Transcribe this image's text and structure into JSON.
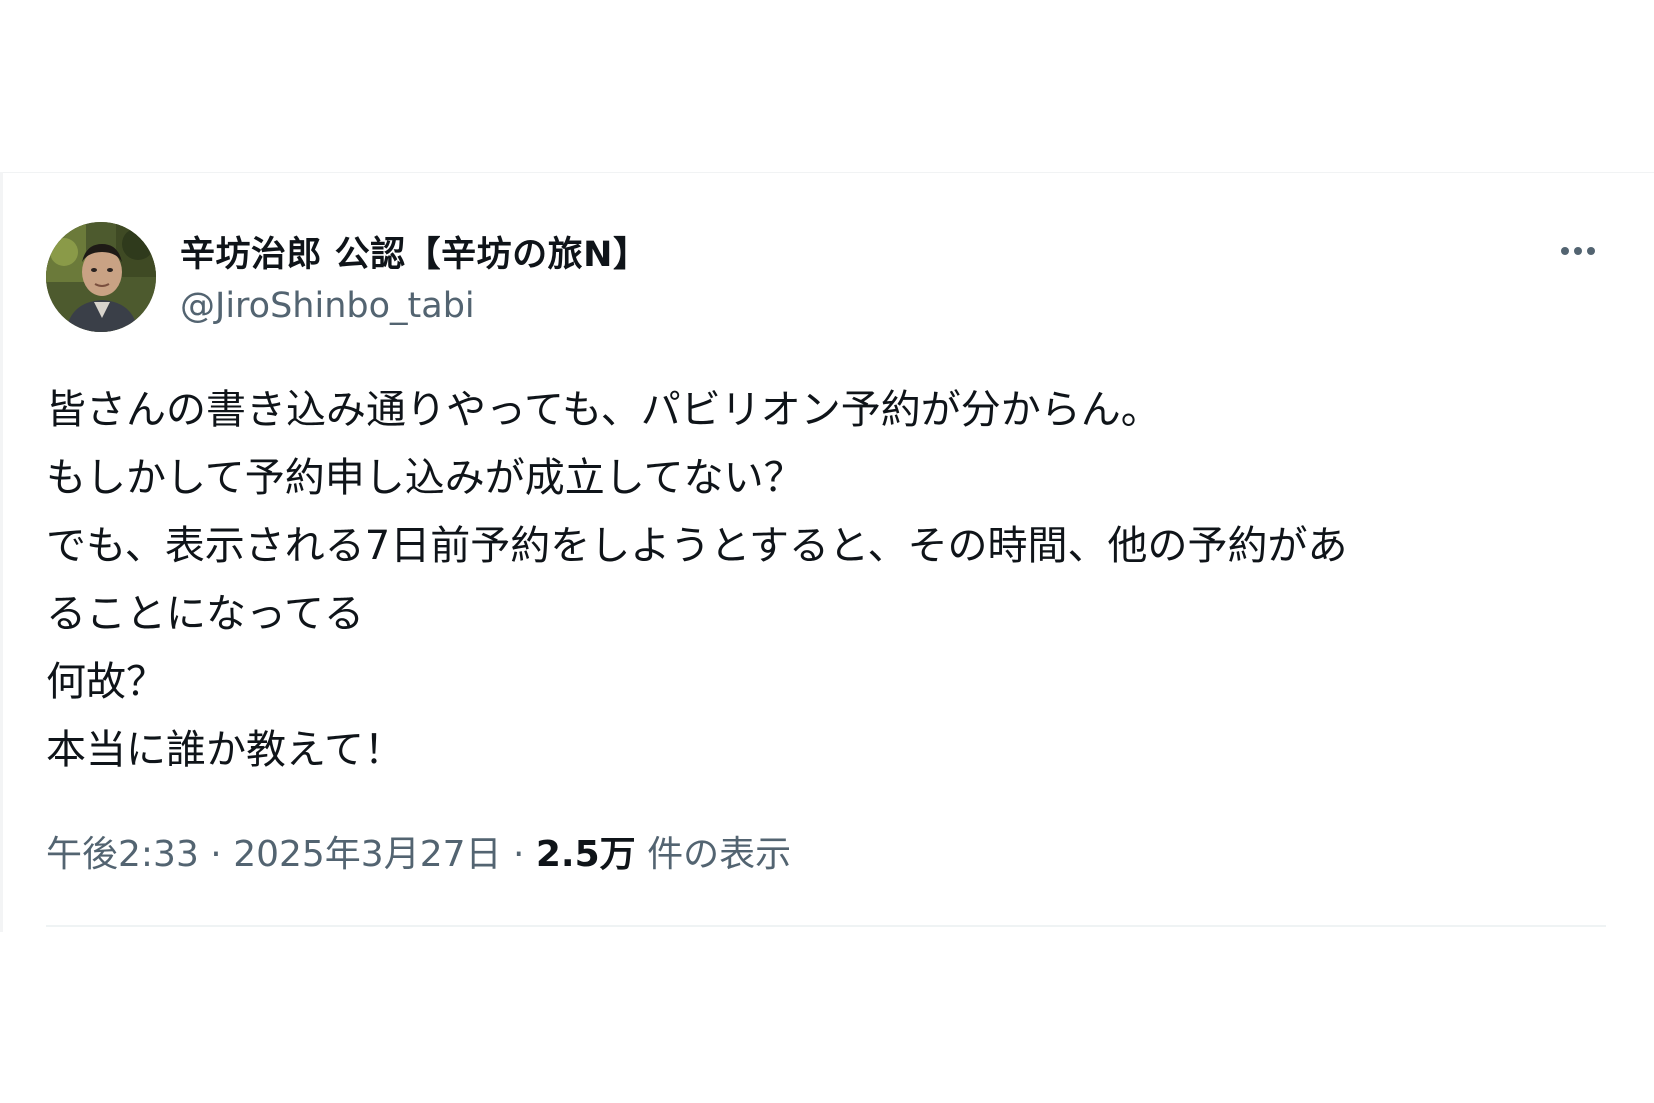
{
  "author": {
    "display_name": "辛坊治郎 公認【辛坊の旅N】",
    "handle": "@JiroShinbo_tabi",
    "avatar_icon": "user-avatar-photo"
  },
  "more_icon": "more-dots-icon",
  "tweet": {
    "lines": [
      "皆さんの書き込み通りやっても、パビリオン予約が分からん。",
      "もしかして予約申し込みが成立してない？",
      "でも、表示される7日前予約をしようとすると、その時間、他の予約があ",
      "ることになってる",
      "何故？",
      "本当に誰か教えて！"
    ]
  },
  "meta": {
    "time": "午後2:33",
    "separator1": " · ",
    "date": "2025年3月27日",
    "separator2": " · ",
    "views_count": "2.5万",
    "views_label": " 件の表示"
  },
  "colors": {
    "text_primary": "#0f1419",
    "text_secondary": "#536471",
    "divider": "#eff3f4"
  }
}
